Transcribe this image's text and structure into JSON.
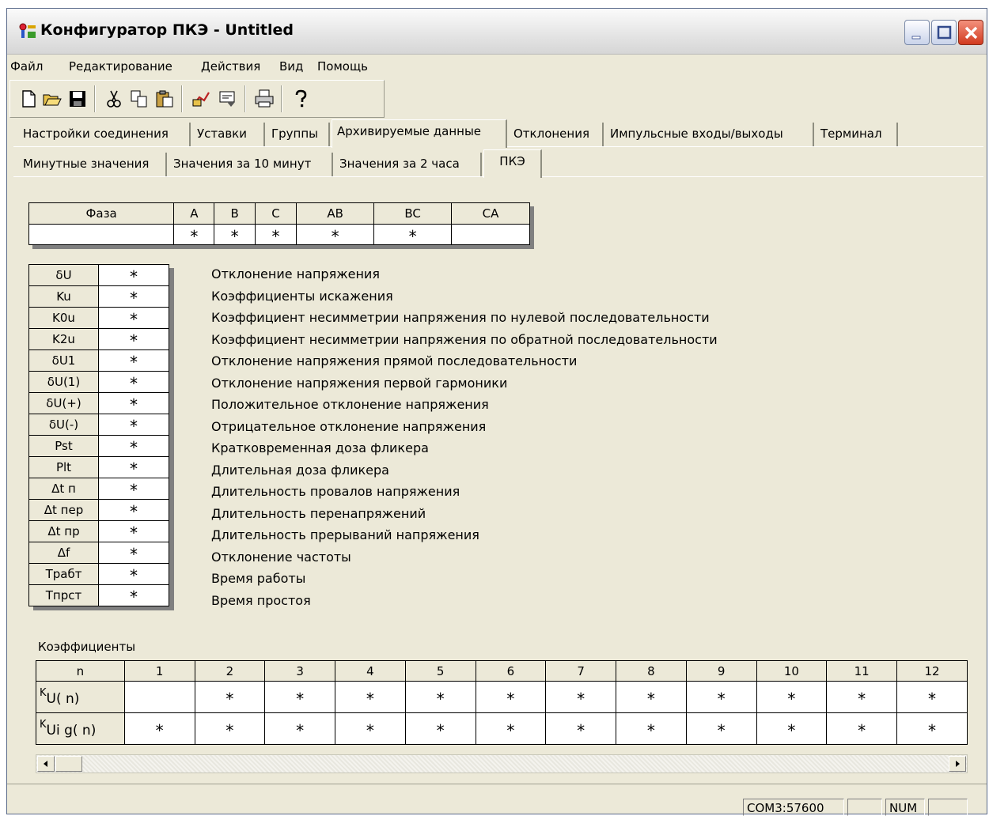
{
  "window": {
    "title": "Конфигуратор ПКЭ - Untitled"
  },
  "menu": [
    "Файл",
    "Редактирование",
    "Действия",
    "Вид",
    "Помощь"
  ],
  "toolbar": [
    "new-icon",
    "open-icon",
    "save-icon",
    "cut-icon",
    "copy-icon",
    "paste-icon",
    "read-device-icon",
    "write-device-icon",
    "print-icon",
    "help-icon"
  ],
  "tabs": [
    "Настройки соединения",
    "Уставки",
    "Группы",
    "Архивируемые данные",
    "Отклонения",
    "Импульсные входы/выходы",
    "Терминал"
  ],
  "subtabs": [
    "Минутные значения",
    "Значения за 10 минут",
    "Значения за 2 часа",
    "ПКЭ"
  ],
  "phase_table": {
    "header": [
      "Фаза",
      "A",
      "B",
      "C",
      "AB",
      "BC",
      "CA"
    ],
    "row": [
      "",
      "*",
      "*",
      "*",
      "*",
      "*",
      ""
    ]
  },
  "params": [
    {
      "code": "δU",
      "mark": "*",
      "desc": "Отклонение напряжения"
    },
    {
      "code": "Ku",
      "mark": "*",
      "desc": "Коэффициенты искажения"
    },
    {
      "code": "K0u",
      "mark": "*",
      "desc": "Коэффициент несимметрии напряжения по нулевой последовательности"
    },
    {
      "code": "K2u",
      "mark": "*",
      "desc": "Коэффициент несимметрии напряжения по обратной последовательности"
    },
    {
      "code": "δU1",
      "mark": "*",
      "desc": "Отклонение напряжения прямой последовательности"
    },
    {
      "code": "δU(1)",
      "mark": "*",
      "desc": "Отклонение напряжения первой гармоники"
    },
    {
      "code": "δU(+)",
      "mark": "*",
      "desc": "Положительное отклонение напряжения"
    },
    {
      "code": "δU(-)",
      "mark": "*",
      "desc": "Отрицательное отклонение напряжения"
    },
    {
      "code": "Pst",
      "mark": "*",
      "desc": "Кратковременная доза фликера"
    },
    {
      "code": "Plt",
      "mark": "*",
      "desc": "Длительная доза фликера"
    },
    {
      "code": "Δt п",
      "mark": "*",
      "desc": "Длительность провалов напряжения"
    },
    {
      "code": "Δt пер",
      "mark": "*",
      "desc": "Длительность перенапряжений"
    },
    {
      "code": "Δt пр",
      "mark": "*",
      "desc": "Длительность прерываний напряжения"
    },
    {
      "code": "Δf",
      "mark": "*",
      "desc": "Отклонение частоты"
    },
    {
      "code": "Трабт",
      "mark": "*",
      "desc": "Время работы"
    },
    {
      "code": "Тпрст",
      "mark": "*",
      "desc": "Время простоя"
    }
  ],
  "coefficients": {
    "label": "Коэффициенты",
    "header": [
      "n",
      "1",
      "2",
      "3",
      "4",
      "5",
      "6",
      "7",
      "8",
      "9",
      "10",
      "11",
      "12"
    ],
    "rows": [
      {
        "base": "K",
        "sub": "U( n)",
        "cells": [
          "",
          "*",
          "*",
          "*",
          "*",
          "*",
          "*",
          "*",
          "*",
          "*",
          "*",
          "*"
        ]
      },
      {
        "base": "K",
        "sub": "Ui g( n)",
        "cells": [
          "*",
          "*",
          "*",
          "*",
          "*",
          "*",
          "*",
          "*",
          "*",
          "*",
          "*",
          "*"
        ]
      }
    ]
  },
  "status": {
    "port": "COM3:57600",
    "blank1": "",
    "num": "NUM",
    "blank2": ""
  }
}
